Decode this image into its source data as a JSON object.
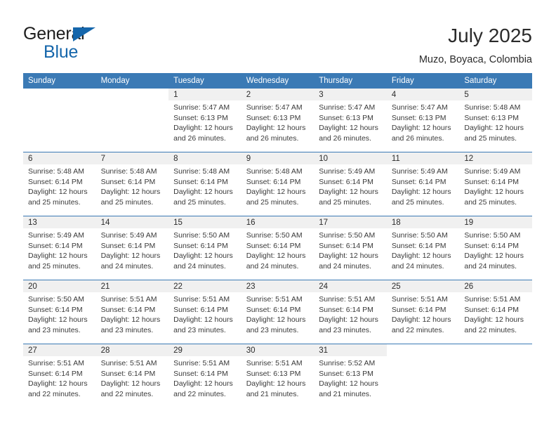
{
  "brand": {
    "name_part1": "General",
    "name_part2": "Blue",
    "flag_icon": "triangle-flag-icon"
  },
  "header": {
    "title": "July 2025",
    "location": "Muzo, Boyaca, Colombia"
  },
  "colors": {
    "header_blue": "#3b7ab5",
    "brand_blue": "#1566ab",
    "daynum_band": "#f0f0f0",
    "text": "#2b2b2b"
  },
  "weekday_headers": [
    "Sunday",
    "Monday",
    "Tuesday",
    "Wednesday",
    "Thursday",
    "Friday",
    "Saturday"
  ],
  "labels": {
    "sunrise_prefix": "Sunrise:",
    "sunset_prefix": "Sunset:",
    "daylight_prefix": "Daylight:"
  },
  "weeks": [
    [
      {
        "day": "",
        "blank": true
      },
      {
        "day": "",
        "blank": true
      },
      {
        "day": "1",
        "sunrise": "Sunrise: 5:47 AM",
        "sunset": "Sunset: 6:13 PM",
        "daylight_line1": "Daylight: 12 hours",
        "daylight_line2": "and 26 minutes."
      },
      {
        "day": "2",
        "sunrise": "Sunrise: 5:47 AM",
        "sunset": "Sunset: 6:13 PM",
        "daylight_line1": "Daylight: 12 hours",
        "daylight_line2": "and 26 minutes."
      },
      {
        "day": "3",
        "sunrise": "Sunrise: 5:47 AM",
        "sunset": "Sunset: 6:13 PM",
        "daylight_line1": "Daylight: 12 hours",
        "daylight_line2": "and 26 minutes."
      },
      {
        "day": "4",
        "sunrise": "Sunrise: 5:47 AM",
        "sunset": "Sunset: 6:13 PM",
        "daylight_line1": "Daylight: 12 hours",
        "daylight_line2": "and 26 minutes."
      },
      {
        "day": "5",
        "sunrise": "Sunrise: 5:48 AM",
        "sunset": "Sunset: 6:13 PM",
        "daylight_line1": "Daylight: 12 hours",
        "daylight_line2": "and 25 minutes."
      }
    ],
    [
      {
        "day": "6",
        "sunrise": "Sunrise: 5:48 AM",
        "sunset": "Sunset: 6:14 PM",
        "daylight_line1": "Daylight: 12 hours",
        "daylight_line2": "and 25 minutes."
      },
      {
        "day": "7",
        "sunrise": "Sunrise: 5:48 AM",
        "sunset": "Sunset: 6:14 PM",
        "daylight_line1": "Daylight: 12 hours",
        "daylight_line2": "and 25 minutes."
      },
      {
        "day": "8",
        "sunrise": "Sunrise: 5:48 AM",
        "sunset": "Sunset: 6:14 PM",
        "daylight_line1": "Daylight: 12 hours",
        "daylight_line2": "and 25 minutes."
      },
      {
        "day": "9",
        "sunrise": "Sunrise: 5:48 AM",
        "sunset": "Sunset: 6:14 PM",
        "daylight_line1": "Daylight: 12 hours",
        "daylight_line2": "and 25 minutes."
      },
      {
        "day": "10",
        "sunrise": "Sunrise: 5:49 AM",
        "sunset": "Sunset: 6:14 PM",
        "daylight_line1": "Daylight: 12 hours",
        "daylight_line2": "and 25 minutes."
      },
      {
        "day": "11",
        "sunrise": "Sunrise: 5:49 AM",
        "sunset": "Sunset: 6:14 PM",
        "daylight_line1": "Daylight: 12 hours",
        "daylight_line2": "and 25 minutes."
      },
      {
        "day": "12",
        "sunrise": "Sunrise: 5:49 AM",
        "sunset": "Sunset: 6:14 PM",
        "daylight_line1": "Daylight: 12 hours",
        "daylight_line2": "and 25 minutes."
      }
    ],
    [
      {
        "day": "13",
        "sunrise": "Sunrise: 5:49 AM",
        "sunset": "Sunset: 6:14 PM",
        "daylight_line1": "Daylight: 12 hours",
        "daylight_line2": "and 25 minutes."
      },
      {
        "day": "14",
        "sunrise": "Sunrise: 5:49 AM",
        "sunset": "Sunset: 6:14 PM",
        "daylight_line1": "Daylight: 12 hours",
        "daylight_line2": "and 24 minutes."
      },
      {
        "day": "15",
        "sunrise": "Sunrise: 5:50 AM",
        "sunset": "Sunset: 6:14 PM",
        "daylight_line1": "Daylight: 12 hours",
        "daylight_line2": "and 24 minutes."
      },
      {
        "day": "16",
        "sunrise": "Sunrise: 5:50 AM",
        "sunset": "Sunset: 6:14 PM",
        "daylight_line1": "Daylight: 12 hours",
        "daylight_line2": "and 24 minutes."
      },
      {
        "day": "17",
        "sunrise": "Sunrise: 5:50 AM",
        "sunset": "Sunset: 6:14 PM",
        "daylight_line1": "Daylight: 12 hours",
        "daylight_line2": "and 24 minutes."
      },
      {
        "day": "18",
        "sunrise": "Sunrise: 5:50 AM",
        "sunset": "Sunset: 6:14 PM",
        "daylight_line1": "Daylight: 12 hours",
        "daylight_line2": "and 24 minutes."
      },
      {
        "day": "19",
        "sunrise": "Sunrise: 5:50 AM",
        "sunset": "Sunset: 6:14 PM",
        "daylight_line1": "Daylight: 12 hours",
        "daylight_line2": "and 24 minutes."
      }
    ],
    [
      {
        "day": "20",
        "sunrise": "Sunrise: 5:50 AM",
        "sunset": "Sunset: 6:14 PM",
        "daylight_line1": "Daylight: 12 hours",
        "daylight_line2": "and 23 minutes."
      },
      {
        "day": "21",
        "sunrise": "Sunrise: 5:51 AM",
        "sunset": "Sunset: 6:14 PM",
        "daylight_line1": "Daylight: 12 hours",
        "daylight_line2": "and 23 minutes."
      },
      {
        "day": "22",
        "sunrise": "Sunrise: 5:51 AM",
        "sunset": "Sunset: 6:14 PM",
        "daylight_line1": "Daylight: 12 hours",
        "daylight_line2": "and 23 minutes."
      },
      {
        "day": "23",
        "sunrise": "Sunrise: 5:51 AM",
        "sunset": "Sunset: 6:14 PM",
        "daylight_line1": "Daylight: 12 hours",
        "daylight_line2": "and 23 minutes."
      },
      {
        "day": "24",
        "sunrise": "Sunrise: 5:51 AM",
        "sunset": "Sunset: 6:14 PM",
        "daylight_line1": "Daylight: 12 hours",
        "daylight_line2": "and 23 minutes."
      },
      {
        "day": "25",
        "sunrise": "Sunrise: 5:51 AM",
        "sunset": "Sunset: 6:14 PM",
        "daylight_line1": "Daylight: 12 hours",
        "daylight_line2": "and 22 minutes."
      },
      {
        "day": "26",
        "sunrise": "Sunrise: 5:51 AM",
        "sunset": "Sunset: 6:14 PM",
        "daylight_line1": "Daylight: 12 hours",
        "daylight_line2": "and 22 minutes."
      }
    ],
    [
      {
        "day": "27",
        "sunrise": "Sunrise: 5:51 AM",
        "sunset": "Sunset: 6:14 PM",
        "daylight_line1": "Daylight: 12 hours",
        "daylight_line2": "and 22 minutes."
      },
      {
        "day": "28",
        "sunrise": "Sunrise: 5:51 AM",
        "sunset": "Sunset: 6:14 PM",
        "daylight_line1": "Daylight: 12 hours",
        "daylight_line2": "and 22 minutes."
      },
      {
        "day": "29",
        "sunrise": "Sunrise: 5:51 AM",
        "sunset": "Sunset: 6:14 PM",
        "daylight_line1": "Daylight: 12 hours",
        "daylight_line2": "and 22 minutes."
      },
      {
        "day": "30",
        "sunrise": "Sunrise: 5:51 AM",
        "sunset": "Sunset: 6:13 PM",
        "daylight_line1": "Daylight: 12 hours",
        "daylight_line2": "and 21 minutes."
      },
      {
        "day": "31",
        "sunrise": "Sunrise: 5:52 AM",
        "sunset": "Sunset: 6:13 PM",
        "daylight_line1": "Daylight: 12 hours",
        "daylight_line2": "and 21 minutes."
      },
      {
        "day": "",
        "blank": true
      },
      {
        "day": "",
        "blank": true
      }
    ]
  ]
}
